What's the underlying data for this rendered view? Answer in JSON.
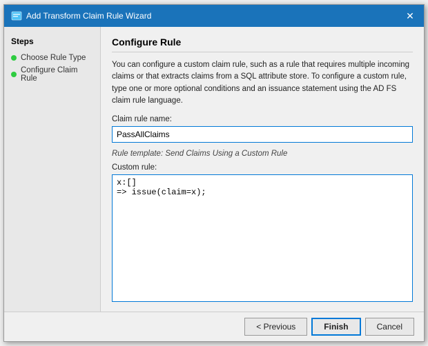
{
  "dialog": {
    "title": "Add Transform Claim Rule Wizard",
    "close_label": "✕"
  },
  "sidebar": {
    "title": "Steps",
    "items": [
      {
        "label": "Choose Rule Type"
      },
      {
        "label": "Configure Claim Rule"
      }
    ]
  },
  "main": {
    "title": "Configure Rule",
    "description": "You can configure a custom claim rule, such as a rule that requires multiple incoming claims or that extracts claims from a SQL attribute store. To configure a custom rule, type one or more optional conditions and an issuance statement using the AD FS claim rule language.",
    "claim_rule_name_label": "Claim rule name:",
    "claim_rule_name_value": "PassAllClaims",
    "rule_template_text": "Rule template: Send Claims Using a Custom Rule",
    "custom_rule_label": "Custom rule:",
    "custom_rule_value": "x:[]\n=> issue(claim=x);"
  },
  "footer": {
    "previous_label": "< Previous",
    "finish_label": "Finish",
    "cancel_label": "Cancel"
  }
}
